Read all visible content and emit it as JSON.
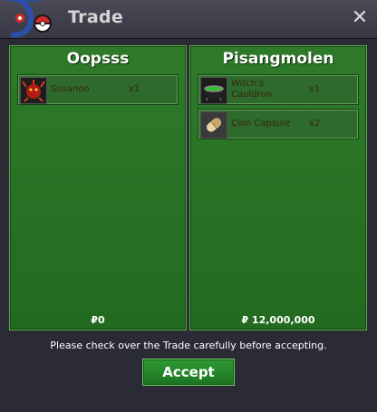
{
  "window": {
    "title": "Trade",
    "close_glyph": "✕"
  },
  "left_panel": {
    "player_name": "Oopsss",
    "items": [
      {
        "name": "Susanoo",
        "qty": "x1",
        "icon": "red-creature-icon"
      }
    ],
    "money": "₽0"
  },
  "right_panel": {
    "player_name": "Pisangmolen",
    "items": [
      {
        "name": "Witch's Cauldron",
        "qty": "x1",
        "icon": "cauldron-icon"
      },
      {
        "name": "Coin Capsule",
        "qty": "x2",
        "icon": "coin-capsule-icon"
      }
    ],
    "money": "₽ 12,000,000"
  },
  "footer": {
    "notice": "Please check over the Trade carefully before accepting.",
    "accept_label": "Accept"
  },
  "colors": {
    "panel_green": "#2f7a2a",
    "item_text": "#3a2412",
    "titlebar": "#4a4a56"
  }
}
